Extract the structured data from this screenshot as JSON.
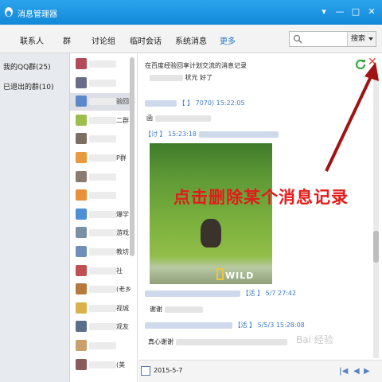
{
  "window": {
    "title": "消息管理器",
    "controls": [
      "▾",
      "—",
      "□",
      "✕"
    ]
  },
  "toolbar": {
    "tabs": [
      "联系人",
      "群",
      "讨论组",
      "临时会话",
      "系统消息",
      "更多"
    ],
    "search_button": "搜索"
  },
  "left_nav": {
    "items": [
      "我的QQ群(25)",
      "已退出的群(10)"
    ]
  },
  "group_list": {
    "tails": [
      "",
      "",
      "验回享",
      "二群",
      "",
      "P群",
      "",
      "",
      "爆学",
      "游戏",
      "教坊",
      "社",
      "(老乡",
      "视城",
      "观友",
      "",
      "(美"
    ]
  },
  "messages": {
    "header": "在百度经验回享计划交流的消息记录",
    "lines": [
      "状元 好了",
      "【 】 7070) 15:22:05",
      "函",
      "【讨 】 15:23:18",
      "【活 】 5/7 27:42",
      "谢谢",
      "【活 】 5/5/3 15:28:08",
      "真心谢谢"
    ],
    "photo_caption": "WILD"
  },
  "annotation": {
    "text": "点击删除某个消息记录"
  },
  "footer": {
    "date": "2015-5-7",
    "watermark": "Bai 经验"
  },
  "colors": {
    "titlebar": "#1e96e2",
    "annotation": "#e31a1a",
    "delete": "#d84a3a",
    "link": "#2777c6"
  }
}
